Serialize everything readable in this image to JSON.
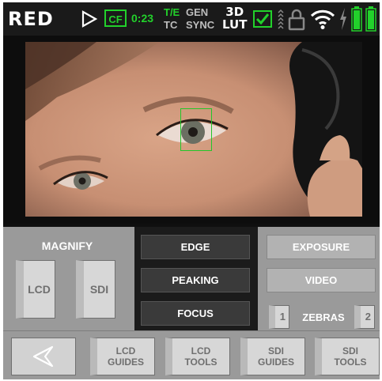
{
  "status_bar": {
    "brand": "RED",
    "media_label": "CF",
    "media_time": "0:23",
    "te_label": "T/E",
    "tc_label": "TC",
    "gen_label": "GEN",
    "sync_label": "SYNC",
    "lut_top": "3D",
    "lut_bottom": "LUT",
    "icons": [
      "play-arrow-icon",
      "checkbox-icon",
      "audio-meter-icon",
      "lock-icon",
      "wifi-icon",
      "power-bolt-icon",
      "battery-icon"
    ],
    "accent_color": "#22d12b"
  },
  "magnify": {
    "label": "MAGNIFY",
    "lcd_label": "LCD",
    "sdi_label": "SDI"
  },
  "focus_tools": {
    "edge_label": "EDGE",
    "peaking_label": "PEAKING",
    "focus_label": "FOCUS"
  },
  "exposure_tools": {
    "exposure_label": "EXPOSURE",
    "video_label": "VIDEO",
    "zebras_label": "ZEBRAS",
    "zebra1_label": "1",
    "zebra2_label": "2"
  },
  "bottom_nav": {
    "back_icon": "back-arrow-icon",
    "items": [
      {
        "line1": "LCD",
        "line2": "GUIDES"
      },
      {
        "line1": "LCD",
        "line2": "TOOLS"
      },
      {
        "line1": "SDI",
        "line2": "GUIDES"
      },
      {
        "line1": "SDI",
        "line2": "TOOLS"
      }
    ]
  }
}
